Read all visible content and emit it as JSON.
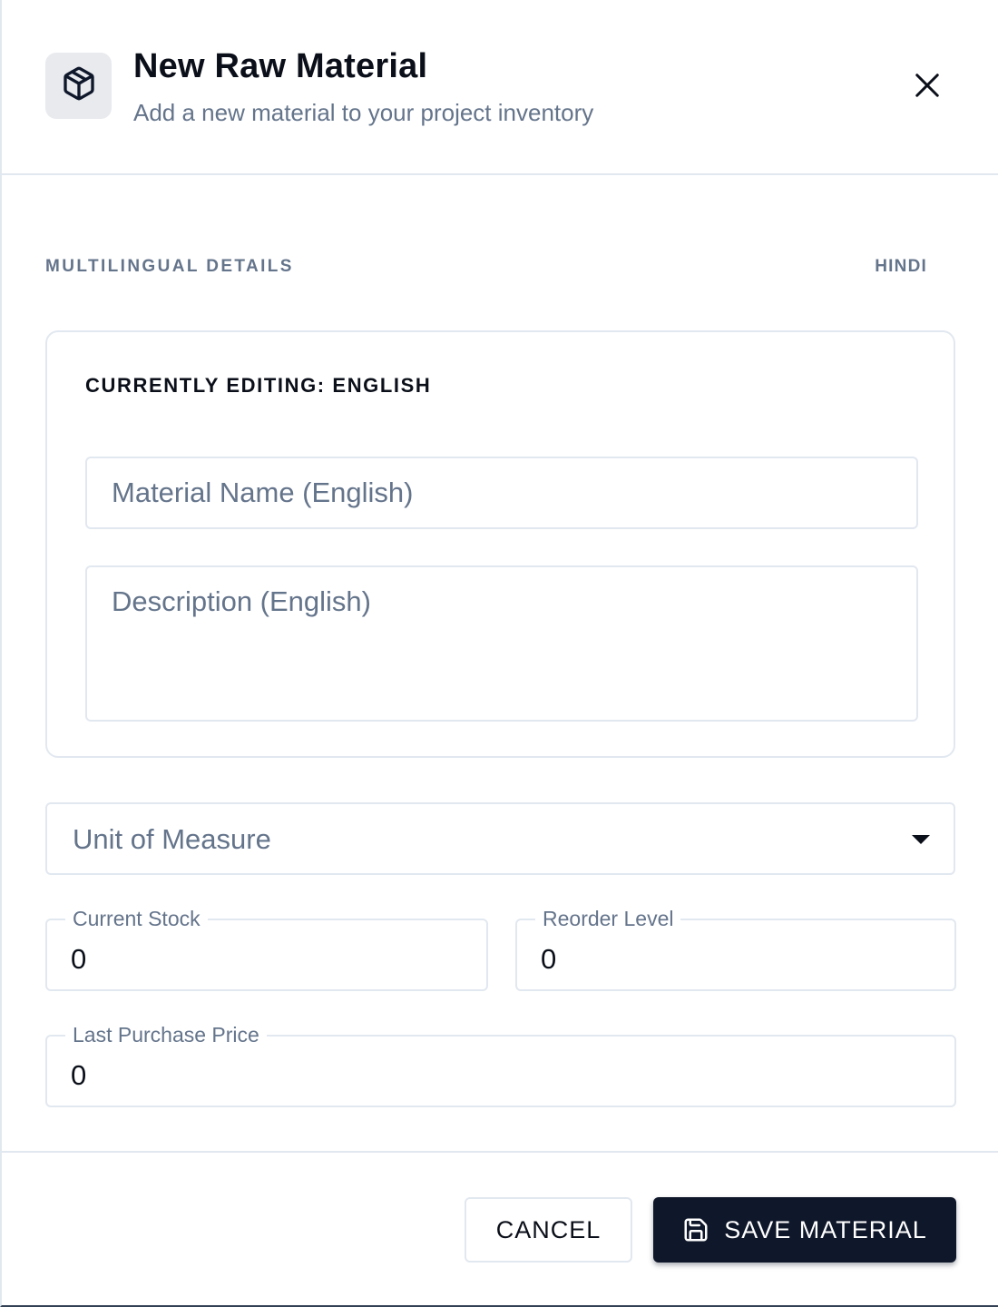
{
  "dialog": {
    "title": "New Raw Material",
    "subtitle": "Add a new material to your project inventory",
    "header_icon": "package-icon",
    "close_icon": "close-icon"
  },
  "multilingual": {
    "section_label": "MULTILINGUAL DETAILS",
    "language_toggle": "HINDI",
    "editing_label": "CURRENTLY EDITING: ENGLISH",
    "name_placeholder": "Material Name (English)",
    "name_value": "",
    "description_placeholder": "Description (English)",
    "description_value": ""
  },
  "unit_of_measure": {
    "placeholder": "Unit of Measure",
    "caret_icon": "caret-down-icon"
  },
  "fields": {
    "current_stock": {
      "label": "Current Stock",
      "value": "0"
    },
    "reorder_level": {
      "label": "Reorder Level",
      "value": "0"
    },
    "last_purchase_price": {
      "label": "Last Purchase Price",
      "value": "0"
    }
  },
  "footer": {
    "cancel_label": "CANCEL",
    "save_label": "SAVE MATERIAL",
    "save_icon": "save-icon"
  },
  "colors": {
    "primary": "#0f172a",
    "muted_text": "#64748b",
    "border": "#e2e8f0",
    "icon_bg": "#e8eaee"
  }
}
